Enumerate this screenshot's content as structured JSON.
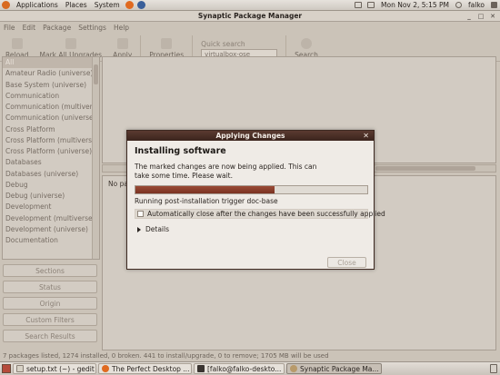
{
  "top_panel": {
    "menus": [
      "Applications",
      "Places",
      "System"
    ],
    "clock": "Mon Nov  2,  5:15 PM",
    "user": "falko"
  },
  "window": {
    "title": "Synaptic Package Manager",
    "menu": [
      "File",
      "Edit",
      "Package",
      "Settings",
      "Help"
    ],
    "toolbar": {
      "reload": "Reload",
      "mark_all": "Mark All Upgrades",
      "apply": "Apply",
      "properties": "Properties",
      "quick_search_label": "Quick search",
      "quick_search_value": "virtualbox-ose",
      "search": "Search"
    },
    "sections": [
      "All",
      "Amateur Radio (universe)",
      "Base System (universe)",
      "Communication",
      "Communication (multiverse)",
      "Communication (universe)",
      "Cross Platform",
      "Cross Platform (multiverse)",
      "Cross Platform (universe)",
      "Databases",
      "Databases (universe)",
      "Debug",
      "Debug (universe)",
      "Development",
      "Development (multiverse)",
      "Development (universe)",
      "Documentation"
    ],
    "filter_buttons": [
      "Sections",
      "Status",
      "Origin",
      "Custom Filters",
      "Search Results"
    ],
    "desc_text": "No pa",
    "status_bar": "7 packages listed, 1274 installed, 0 broken. 441 to install/upgrade, 0 to remove; 1705 MB will be used"
  },
  "dialog": {
    "title": "Applying Changes",
    "heading": "Installing software",
    "message": "The marked changes are now being applied. This can take some time. Please wait.",
    "progress_fraction": 0.6,
    "status": "Running post-installation trigger doc-base",
    "autoclose_label": "Automatically close after the changes have been successfully applied",
    "autoclose_checked": false,
    "details_label": "Details",
    "close_label": "Close"
  },
  "taskbar": {
    "tasks": [
      "setup.txt (~) - gedit",
      "The Perfect Desktop ...",
      "[falko@falko-deskto...",
      "Synaptic Package Ma..."
    ]
  },
  "colors": {
    "accent": "#7a3222",
    "dialog_title": "#3b241d"
  }
}
